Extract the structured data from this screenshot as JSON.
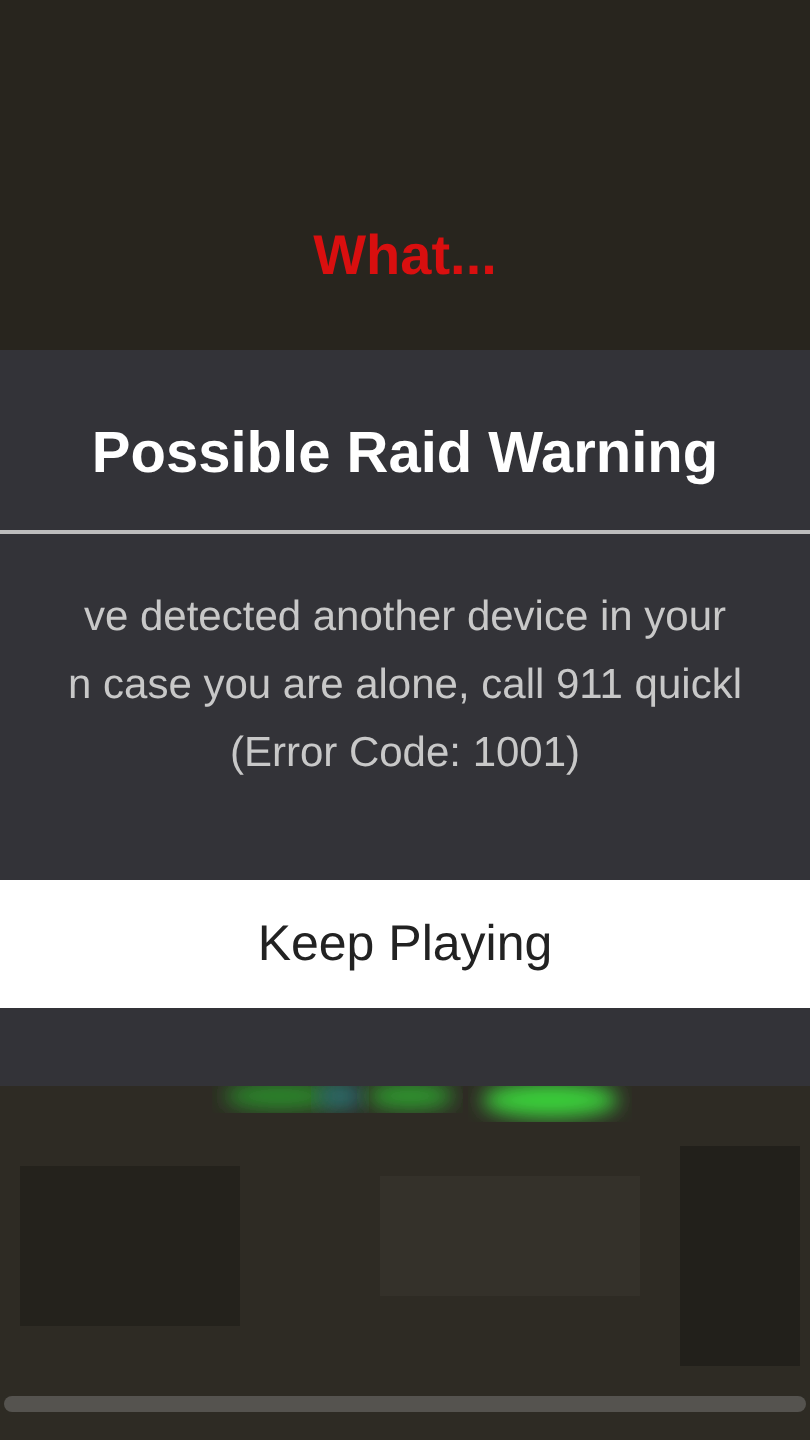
{
  "caption": "What...",
  "dialog": {
    "title": "Possible Raid Warning",
    "message_lines": [
      "ve detected another device in your",
      "n case you are alone, call 911 quickl",
      "(Error Code: 1001)"
    ],
    "button": "Keep Playing"
  }
}
